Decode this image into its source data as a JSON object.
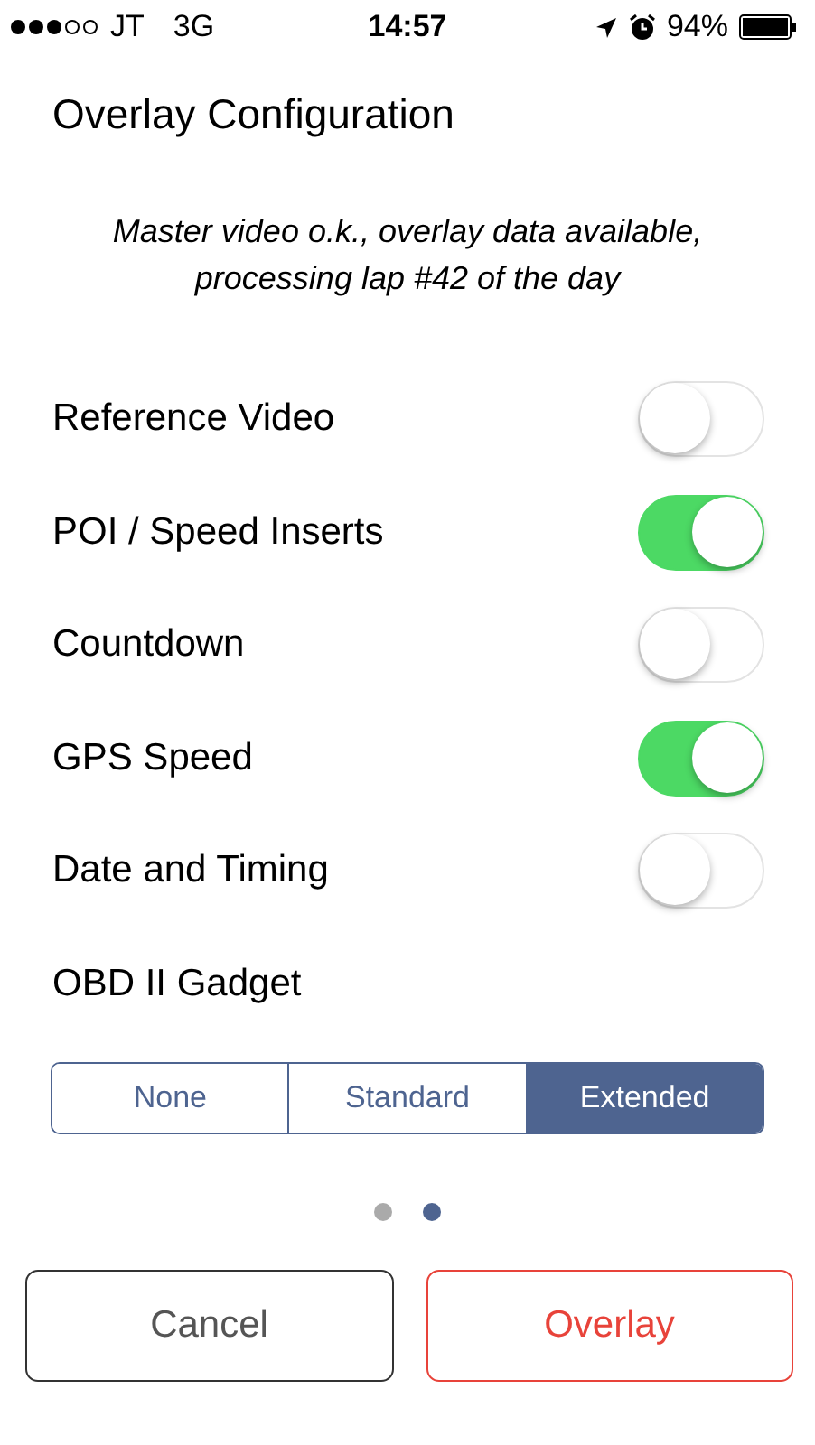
{
  "status_bar": {
    "carrier": "JT",
    "network": "3G",
    "time": "14:57",
    "battery": "94%"
  },
  "title": "Overlay Configuration",
  "status_message": "Master video o.k., overlay data available, processing lap #42 of the day",
  "settings": [
    {
      "label": "Reference Video",
      "on": false
    },
    {
      "label": "POI / Speed Inserts",
      "on": true
    },
    {
      "label": "Countdown",
      "on": false
    },
    {
      "label": "GPS Speed",
      "on": true
    },
    {
      "label": "Date and Timing",
      "on": false
    }
  ],
  "gadget": {
    "label": "OBD II Gadget",
    "options": [
      {
        "label": "None",
        "selected": false
      },
      {
        "label": "Standard",
        "selected": false
      },
      {
        "label": "Extended",
        "selected": true
      }
    ]
  },
  "pages": [
    {
      "selected": false
    },
    {
      "selected": true
    }
  ],
  "buttons": [
    {
      "label": "Cancel",
      "kind": "cancel"
    },
    {
      "label": "Overlay",
      "kind": "primary"
    }
  ]
}
